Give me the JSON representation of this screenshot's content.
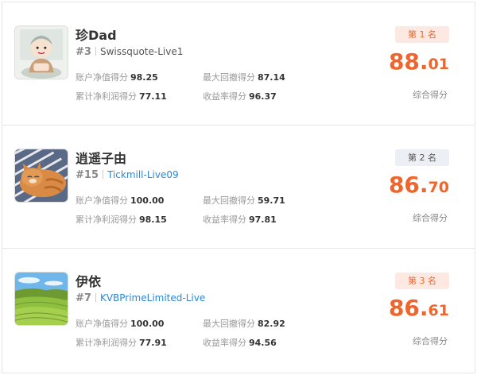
{
  "labels": {
    "equity": "账户净值得分",
    "drawdown": "最大回撤得分",
    "profit": "累计净利润得分",
    "yield": "收益率得分",
    "composite": "综合得分"
  },
  "colors": {
    "accent": "#f0652b",
    "link": "#2b87d8",
    "gold_badge_bg": "#fde9e1",
    "gray_badge_bg": "#eceff3"
  },
  "entries": [
    {
      "name": "珍Dad",
      "rank_no": "#3",
      "account": "Swissquote-Live1",
      "equity": "98.25",
      "drawdown": "87.14",
      "profit": "77.11",
      "yield": "96.37",
      "badge": "第 1 名",
      "score_int": "88.",
      "score_dec": "01",
      "avatar_icon": "cartoon-avatar-icon"
    },
    {
      "name": "逍遥子由",
      "rank_no": "#15",
      "account": "Tickmill-Live09",
      "equity": "100.00",
      "drawdown": "59.71",
      "profit": "98.15",
      "yield": "97.81",
      "badge": "第 2 名",
      "score_int": "86.",
      "score_dec": "70",
      "avatar_icon": "cat-photo-icon"
    },
    {
      "name": "伊依",
      "rank_no": "#7",
      "account": "KVBPrimeLimited-Live",
      "equity": "100.00",
      "drawdown": "82.92",
      "profit": "77.91",
      "yield": "94.56",
      "badge": "第 3 名",
      "score_int": "86.",
      "score_dec": "61",
      "avatar_icon": "landscape-photo-icon"
    }
  ]
}
